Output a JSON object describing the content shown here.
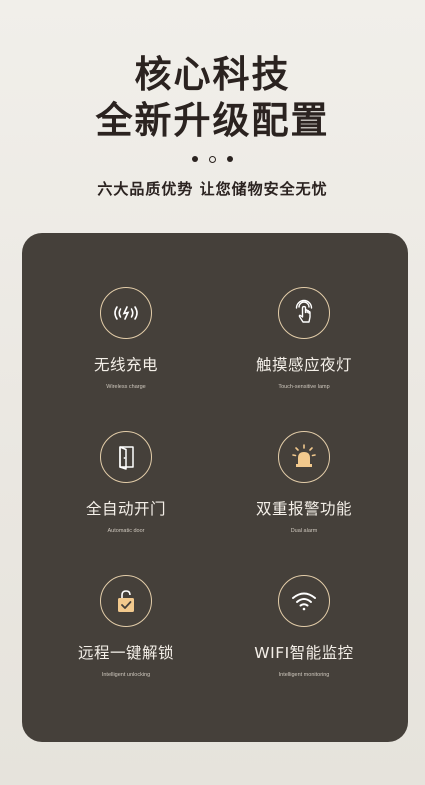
{
  "header": {
    "line1": "核心科技",
    "line2": "全新升级配置",
    "subtitle": "六大品质优势 让您储物安全无忧"
  },
  "features": [
    {
      "title": "无线充电",
      "subtitle": "Wireless charge",
      "icon": "wireless-charge-icon"
    },
    {
      "title": "触摸感应夜灯",
      "subtitle": "Touch-sensitive lamp",
      "icon": "touch-hand-icon"
    },
    {
      "title": "全自动开门",
      "subtitle": "Automatic door",
      "icon": "door-icon"
    },
    {
      "title": "双重报警功能",
      "subtitle": "Dual alarm",
      "icon": "alarm-siren-icon"
    },
    {
      "title": "远程一键解锁",
      "subtitle": "Intelligent unlocking",
      "icon": "unlock-bag-icon"
    },
    {
      "title": "WIFI智能监控",
      "subtitle": "Intelligent monitoring",
      "icon": "wifi-icon"
    }
  ],
  "colors": {
    "background": "#eae7e1",
    "panel": "#45403a",
    "accent_gold": "#e3cda9",
    "heading": "#2b2320"
  }
}
